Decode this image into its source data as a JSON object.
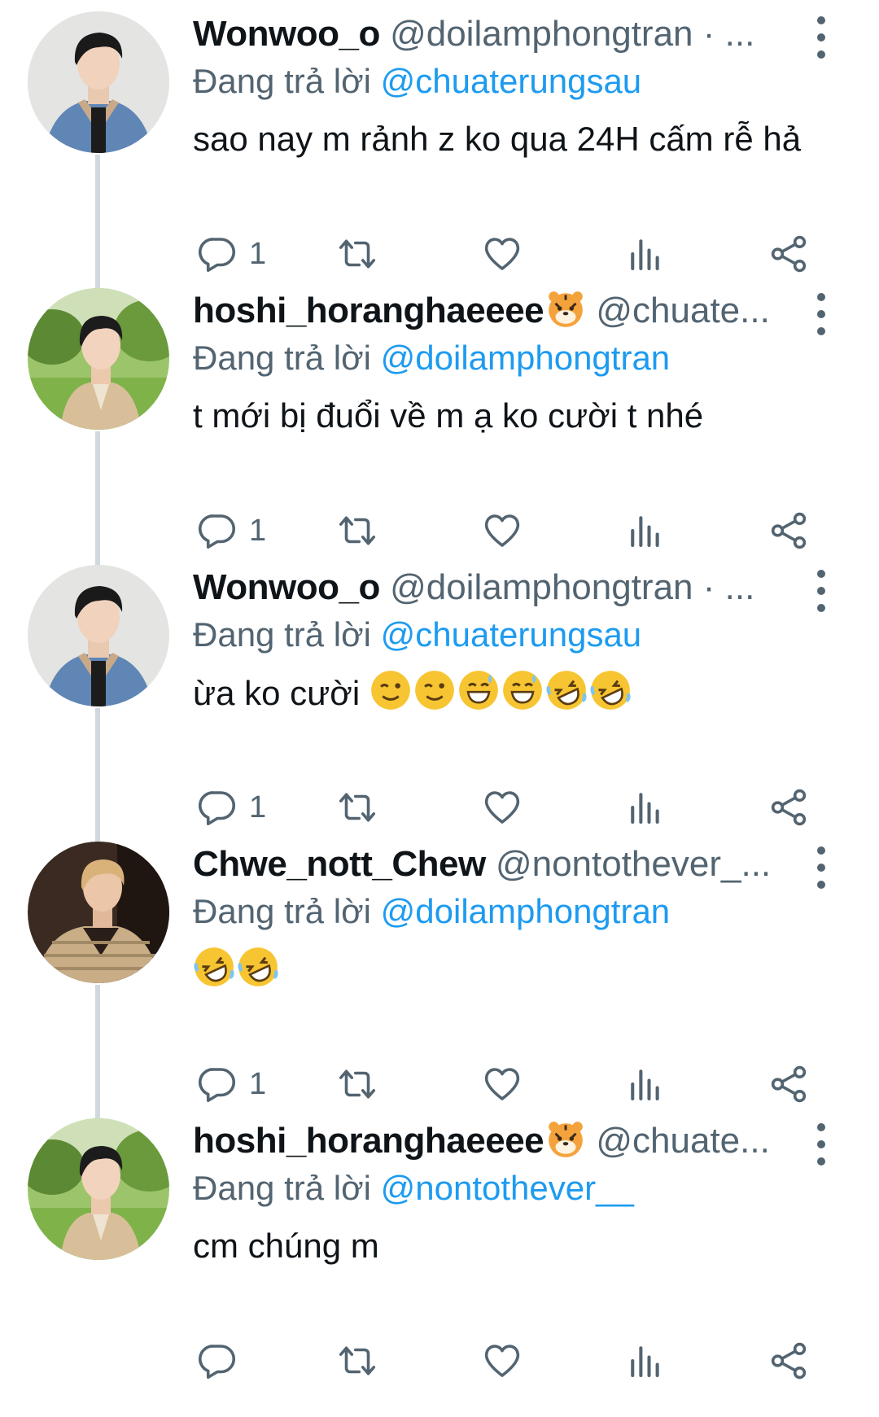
{
  "tweets": [
    {
      "display_name": "Wonwoo_o",
      "handle": "@doilamphongtran · ...",
      "reply_prefix": "Đang trả lời",
      "reply_to": "@chuaterungsau",
      "text": "sao nay m rảnh z ko qua 24H cấm rễ hả",
      "reply_count": "1",
      "avatar": "person-denim-jacket"
    },
    {
      "display_name": "hoshi_horanghaeeee",
      "name_emoji": "tiger-face",
      "handle": "@chuate...",
      "reply_prefix": "Đang trả lời",
      "reply_to": "@doilamphongtran",
      "text": "t mới bị đuổi về m ạ ko cười t nhé",
      "reply_count": "1",
      "avatar": "person-beige-suit-park"
    },
    {
      "display_name": "Wonwoo_o",
      "handle": "@doilamphongtran · ...",
      "reply_prefix": "Đang trả lời",
      "reply_to": "@chuaterungsau",
      "text": "ừa ko cười ",
      "emojis": [
        "winking-face",
        "winking-face",
        "grinning-sweat",
        "grinning-sweat",
        "rolling-laughing",
        "rolling-laughing"
      ],
      "reply_count": "1",
      "avatar": "person-denim-jacket"
    },
    {
      "display_name": "Chwe_nott_Chew",
      "handle": "@nontothever_...",
      "reply_prefix": "Đang trả lời",
      "reply_to": "@doilamphongtran",
      "text": "",
      "emojis": [
        "rolling-laughing",
        "rolling-laughing"
      ],
      "reply_count": "1",
      "avatar": "person-knit-sweater"
    },
    {
      "display_name": "hoshi_horanghaeeee",
      "name_emoji": "tiger-face",
      "handle": "@chuate...",
      "reply_prefix": "Đang trả lời",
      "reply_to": "@nontothever__",
      "text": "cm chúng m",
      "reply_count": "",
      "avatar": "person-beige-suit-park"
    }
  ],
  "icons": {
    "reply": "reply-icon",
    "retweet": "retweet-icon",
    "like": "heart-icon",
    "views": "views-icon",
    "share": "share-icon",
    "more": "more-vertical-icon"
  },
  "colors": {
    "accent": "#1d9bf0",
    "secondary_text": "#536471",
    "thread_line": "#cfd9de"
  }
}
